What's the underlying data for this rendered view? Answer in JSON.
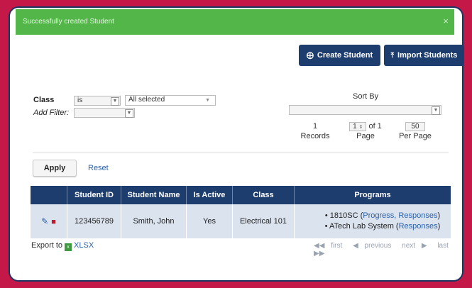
{
  "alert": {
    "message": "Successfully created Student",
    "close": "×"
  },
  "toolbar": {
    "create_label": "Create Student",
    "import_label": "Import Students"
  },
  "filters": {
    "class_label": "Class",
    "operator_value": "is",
    "class_value": "All selected",
    "add_filter_label": "Add Filter:",
    "add_filter_value": ""
  },
  "sort": {
    "label": "Sort By",
    "value": ""
  },
  "pager": {
    "records_value": "1",
    "records_label": "Records",
    "page_value": "1",
    "page_of": "of 1",
    "page_label": "Page",
    "per_page_value": "50",
    "per_page_label": "Per Page"
  },
  "actions": {
    "apply_label": "Apply",
    "reset_label": "Reset"
  },
  "table": {
    "headers": [
      "",
      "Student ID",
      "Student Name",
      "Is Active",
      "Class",
      "Programs"
    ],
    "rows": [
      {
        "student_id": "123456789",
        "student_name": "Smith, John",
        "is_active": "Yes",
        "class": "Electrical 101",
        "programs": [
          {
            "name": "1810SC",
            "links": "Progress, Responses"
          },
          {
            "name": "ATech Lab System",
            "links": "Responses"
          }
        ]
      }
    ]
  },
  "export": {
    "label": "Export to",
    "format": "XLSX"
  },
  "pagination": {
    "first": "first",
    "previous": "previous",
    "next": "next",
    "last": "last"
  },
  "colors": {
    "background": "#c41848",
    "navy": "#1d3d6e",
    "success": "#52b748",
    "link": "#2a5fa8",
    "row": "#dbe3ef"
  }
}
